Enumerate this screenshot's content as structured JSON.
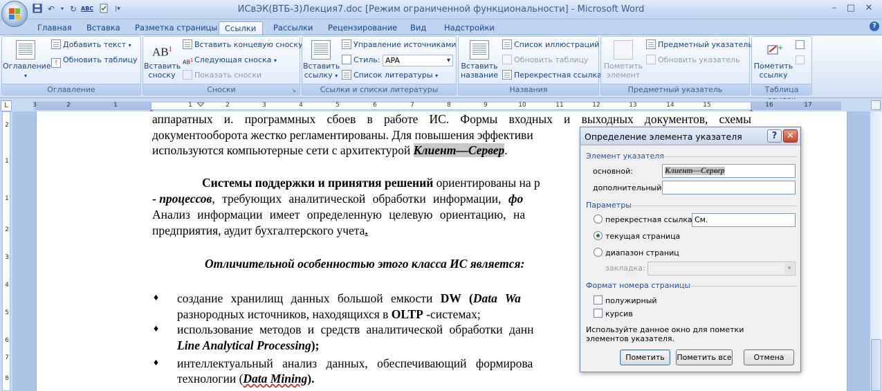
{
  "window": {
    "title": "ИСвЭК(ВТБ-3)Лекция7.doc [Режим ограниченной функциональности] - Microsoft Word",
    "minimize": "–",
    "maximize": "□",
    "close": "✕"
  },
  "quick_access": {
    "undo": "↶",
    "redo": "↻",
    "spell": "ABC"
  },
  "tabs": [
    "Главная",
    "Вставка",
    "Разметка страницы",
    "Ссылки",
    "Рассылки",
    "Рецензирование",
    "Вид",
    "Надстройки"
  ],
  "active_tab": "Ссылки",
  "help": "?",
  "ribbon": {
    "toc": {
      "label": "Оглавление",
      "button": "Оглавление",
      "add_text": "Добавить текст",
      "update_table": "Обновить таблицу"
    },
    "footnotes": {
      "label": "Сноски",
      "insert_line1": "Вставить",
      "insert_line2": "сноску",
      "ab_icon": "AB",
      "insert_endnote": "Вставить концевую сноску",
      "next_footnote": "Следующая сноска",
      "show_notes": "Показать сноски"
    },
    "citations": {
      "label": "Ссылки и списки литературы",
      "insert_line1": "Вставить",
      "insert_line2": "ссылку",
      "manage_sources": "Управление источниками",
      "style_label": "Стиль:",
      "style_value": "APA",
      "bibliography": "Список литературы"
    },
    "captions": {
      "label": "Названия",
      "insert_line1": "Вставить",
      "insert_line2": "название",
      "table_of_figures": "Список иллюстраций",
      "update_table": "Обновить таблицу",
      "cross_reference": "Перекрестная ссылка"
    },
    "index": {
      "label": "Предметный указатель",
      "mark_line1": "Пометить",
      "mark_line2": "элемент",
      "insert_index": "Предметный указатель",
      "update_index": "Обновить указатель"
    },
    "toa": {
      "label": "Таблица ссылок",
      "mark_line1": "Пометить",
      "mark_line2": "ссылку"
    }
  },
  "ruler": {
    "tab_selector": "L",
    "h_numbers": [
      "3",
      "2",
      "1",
      "1",
      "2",
      "3",
      "4",
      "5",
      "6",
      "7",
      "8",
      "9",
      "10",
      "11",
      "12",
      "13",
      "14",
      "15",
      "16",
      "17"
    ],
    "v_numbers": [
      "2",
      "1",
      "1",
      "2",
      "3",
      "4",
      "5",
      "6",
      "7",
      "8"
    ]
  },
  "document": {
    "l1": "аппаратных и. программных сбоев в работе ИС. Формы входных и выходных документов, схемы",
    "l2": "документооборота жестко регламентированы. Для повышения эффективи",
    "l3a": "используются компьютерные сети с архитектурой ",
    "l3b": "Клиент—Сервер",
    "l3c": ".",
    "l4a": "Системы поддержки и принятия решений",
    "l4b": " ориентированы на р",
    "l5a": "- ",
    "l5b": "процессов",
    "l5c": ", требующих аналитической обработки информации, ",
    "l5d": "фо",
    "l6": "Анализ информации имеет определенную целевую ориентацию, на",
    "l7a": "предприятия, аудит бухгалтерского учета",
    "l7b": ".",
    "heading": "Отличительной особенностью этого класса ИС является:",
    "b1a": "создание хранилищ данных большой емкости ",
    "b1b": "DW",
    "b1c": " (",
    "b1d": "Data Wa",
    "b1e": "разнородных источников, находящихся в ",
    "b1f": "OLTP",
    "b1g": " -системах;",
    "b2a": "использование методов и средств аналитической обработки данн",
    "b2b": "Line Analytical Processing",
    "b2c": ");",
    "b3a": "интеллектуальный анализ данных, обеспечивающий формирова",
    "b3b": "технологии (",
    "b3c": "Data Mining",
    "b3d": ").",
    "bullet": "♦"
  },
  "dialog": {
    "title": "Определение элемента указателя",
    "help": "?",
    "close": "✕",
    "section_entry": "Элемент указателя",
    "main_label": "основной:",
    "main_value": "Клиент—Сервер",
    "sub_label": "дополнительный:",
    "sub_value": "",
    "section_options": "Параметры",
    "cross_ref_label": "перекрестная ссылка:",
    "cross_ref_value": "См.",
    "current_page": "текущая страница",
    "page_range": "диапазон страниц",
    "bookmark_label": "закладка:",
    "section_format": "Формат номера страницы",
    "bold": "полужирный",
    "italic": "курсив",
    "hint": "Используйте данное окно для пометки элементов указателя.",
    "btn_mark": "Пометить",
    "btn_mark_all": "Пометить все",
    "btn_cancel": "Отмена"
  }
}
